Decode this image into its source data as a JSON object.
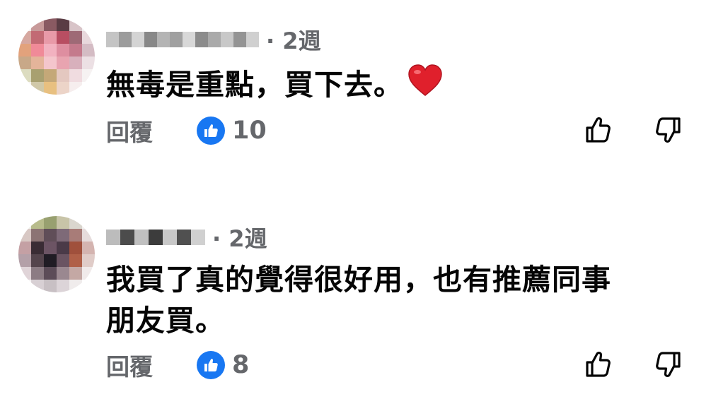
{
  "comments": [
    {
      "time": "· 2週",
      "text": "無毒是重點，買下去。",
      "emoji": "heart-emoji",
      "reply_label": "回覆",
      "like_count": "10"
    },
    {
      "time": "· 2週",
      "text_line1": "我買了真的覺得很好用，也有推薦同事",
      "text_line2": "朋友買。",
      "reply_label": "回覆",
      "like_count": "8"
    }
  ],
  "icons": {
    "like": "thumbs-up-icon",
    "dislike": "thumbs-down-icon",
    "like_badge": "like-badge-icon"
  },
  "colors": {
    "accent": "#1877f2",
    "secondary_text": "#65676b",
    "primary_text": "#050505",
    "heart": "#e0202c"
  }
}
